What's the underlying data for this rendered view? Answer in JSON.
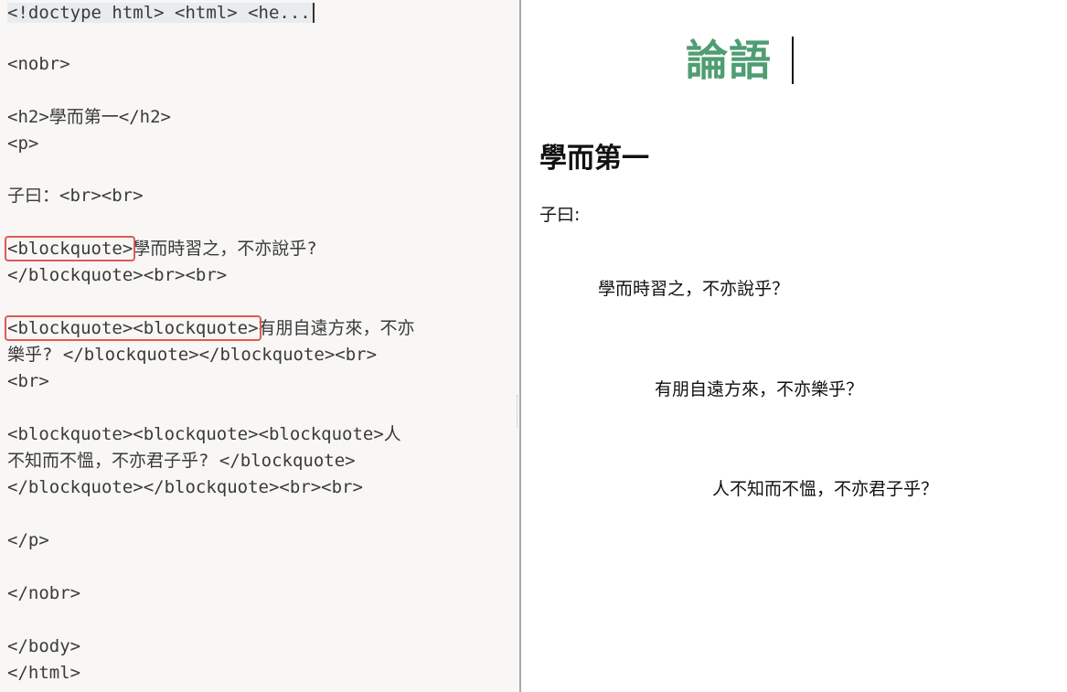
{
  "editor": {
    "collapsed_head": "<!doctype html> <html> <he...",
    "lines": {
      "nobr_open": "<nobr>",
      "h2": "<h2>學而第一</h2>",
      "p_open": "<p>",
      "ziyue": "子曰：<br><br>",
      "bq1_tag": "<blockquote>",
      "bq1_text": "學而時習之，不亦說乎?",
      "bq1_close": "</blockquote><br><br>",
      "bq2_tag": "<blockquote><blockquote>",
      "bq2_text": "有朋自遠方來，不亦",
      "bq2_cont": "樂乎? </blockquote></blockquote><br>",
      "bq2_br": "<br>",
      "bq3_open": "<blockquote><blockquote><blockquote>人",
      "bq3_text": "不知而不慍，不亦君子乎? </blockquote>",
      "bq3_close": "</blockquote></blockquote><br><br>",
      "p_close": "</p>",
      "nobr_close": "</nobr>",
      "body_close": "</body>",
      "html_close": "</html>"
    }
  },
  "preview": {
    "title": "論語",
    "heading": "學而第一",
    "ziyue": "子曰:",
    "quote1": "學而時習之，不亦說乎？",
    "quote2": "有朋自遠方來，不亦樂乎？",
    "quote3": "人不知而不慍，不亦君子乎？"
  },
  "colors": {
    "title_green": "#4f9d72",
    "highlight_red": "#e05a55",
    "editor_bg": "#f8f7f5"
  }
}
